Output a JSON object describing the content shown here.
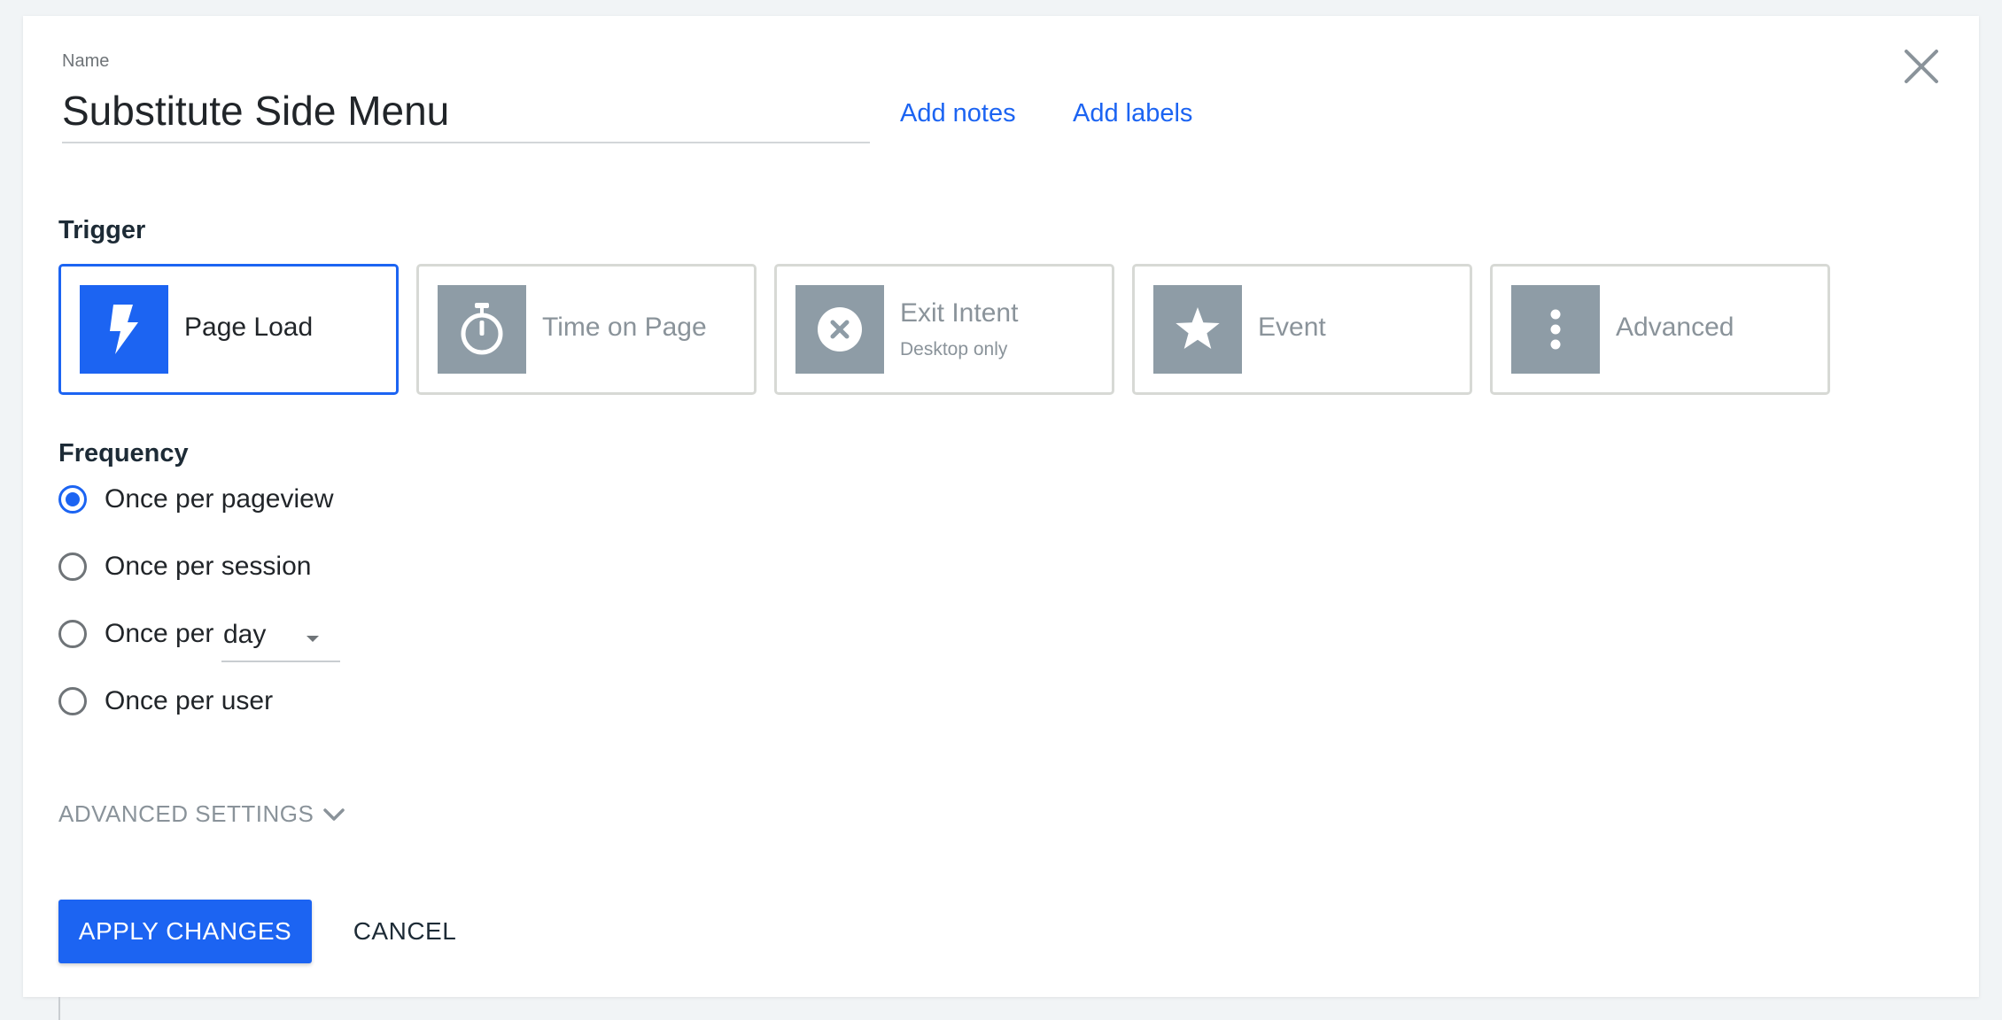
{
  "dialog": {
    "name_label": "Name",
    "name_value": "Substitute Side Menu",
    "add_notes": "Add notes",
    "add_labels": "Add labels"
  },
  "trigger": {
    "title": "Trigger",
    "selected": "page-load",
    "options": [
      {
        "id": "page-load",
        "label": "Page Load",
        "icon": "lightning-bolt-icon"
      },
      {
        "id": "time-on-page",
        "label": "Time on Page",
        "icon": "stopwatch-icon"
      },
      {
        "id": "exit-intent",
        "label": "Exit Intent",
        "sublabel": "Desktop only",
        "icon": "circle-x-icon"
      },
      {
        "id": "event",
        "label": "Event",
        "icon": "star-icon"
      },
      {
        "id": "advanced",
        "label": "Advanced",
        "icon": "vertical-dots-icon"
      }
    ]
  },
  "frequency": {
    "title": "Frequency",
    "selected": "pageview",
    "options": [
      {
        "id": "pageview",
        "label": "Once per pageview"
      },
      {
        "id": "session",
        "label": "Once per session"
      },
      {
        "id": "per-period",
        "label": "Once per",
        "period_value": "day"
      },
      {
        "id": "user",
        "label": "Once per user"
      }
    ]
  },
  "advanced_settings_label": "ADVANCED SETTINGS",
  "buttons": {
    "apply": "APPLY CHANGES",
    "cancel": "CANCEL"
  },
  "colors": {
    "accent": "#1c64f2",
    "icon_tile_inactive": "#8e9ca6",
    "text_muted": "#8a939a",
    "background": "#f1f4f6"
  }
}
